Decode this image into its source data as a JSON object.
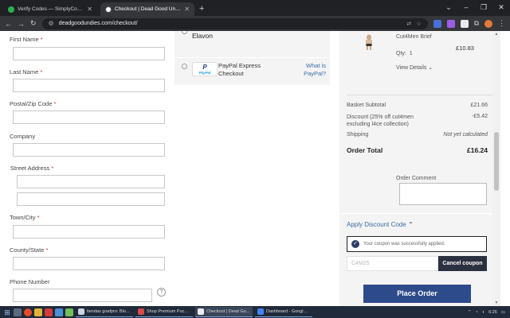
{
  "browser": {
    "tabs": [
      {
        "title": "Verify Codes — SimplyCodes",
        "favicon_color": "#2bb24c",
        "active": false
      },
      {
        "title": "Checkout | Dead Good Undies",
        "favicon_color": "#ffffff",
        "active": true
      }
    ],
    "new_tab": "+",
    "url": "deadgoodundies.com/checkout/"
  },
  "form": {
    "fields": [
      {
        "label": "First Name",
        "required": true
      },
      {
        "label": "Last Name",
        "required": true
      },
      {
        "label": "Postal/Zip Code",
        "required": true
      },
      {
        "label": "Company",
        "required": false
      },
      {
        "label": "Street Address",
        "required": true
      },
      {
        "label": "Town/City",
        "required": true
      },
      {
        "label": "County/State",
        "required": true
      },
      {
        "label": "Phone Number",
        "required": false
      }
    ],
    "required_mark": "*",
    "help_icon": "?"
  },
  "payment": {
    "elavon_label": "Elavon",
    "paypal_title": "PayPal Express Checkout",
    "paypal_logo_text": "PayPal",
    "what_is_paypal": "What is PayPal?"
  },
  "summary": {
    "product_name": "Cut4Men Brief",
    "product_price": "£10.83",
    "qty_label": "Qty:",
    "qty_value": "1",
    "view_details": "View Details",
    "subtotal_label": "Basket Subtotal",
    "subtotal_value": "£21.66",
    "discount_label": "Discount (25% off cut4men excluding l4ce collection)",
    "discount_value": "-£5.42",
    "shipping_label": "Shipping",
    "shipping_value": "Not yet calculated",
    "total_label": "Order Total",
    "total_value": "£16.24",
    "comment_label": "Order Comment"
  },
  "discount": {
    "toggle_label": "Apply Discount Code",
    "success_message": "Your coupon was successfully applied.",
    "code": "C4M25",
    "cancel_label": "Cancel coupon"
  },
  "place_order_label": "Place Order",
  "taskbar": {
    "apps": [
      {
        "title": "tiendas goafpro: Blo...",
        "active": false
      },
      {
        "title": "Shop Premium Puck ...",
        "active": false
      },
      {
        "title": "Checkout | Dead Go...",
        "active": true
      },
      {
        "title": "Dashboard - Google ...",
        "active": false
      }
    ],
    "time": "6:26"
  },
  "colors": {
    "accent": "#2d4a8a",
    "link": "#3a6ea5",
    "cancel_button": "#2b3140"
  }
}
